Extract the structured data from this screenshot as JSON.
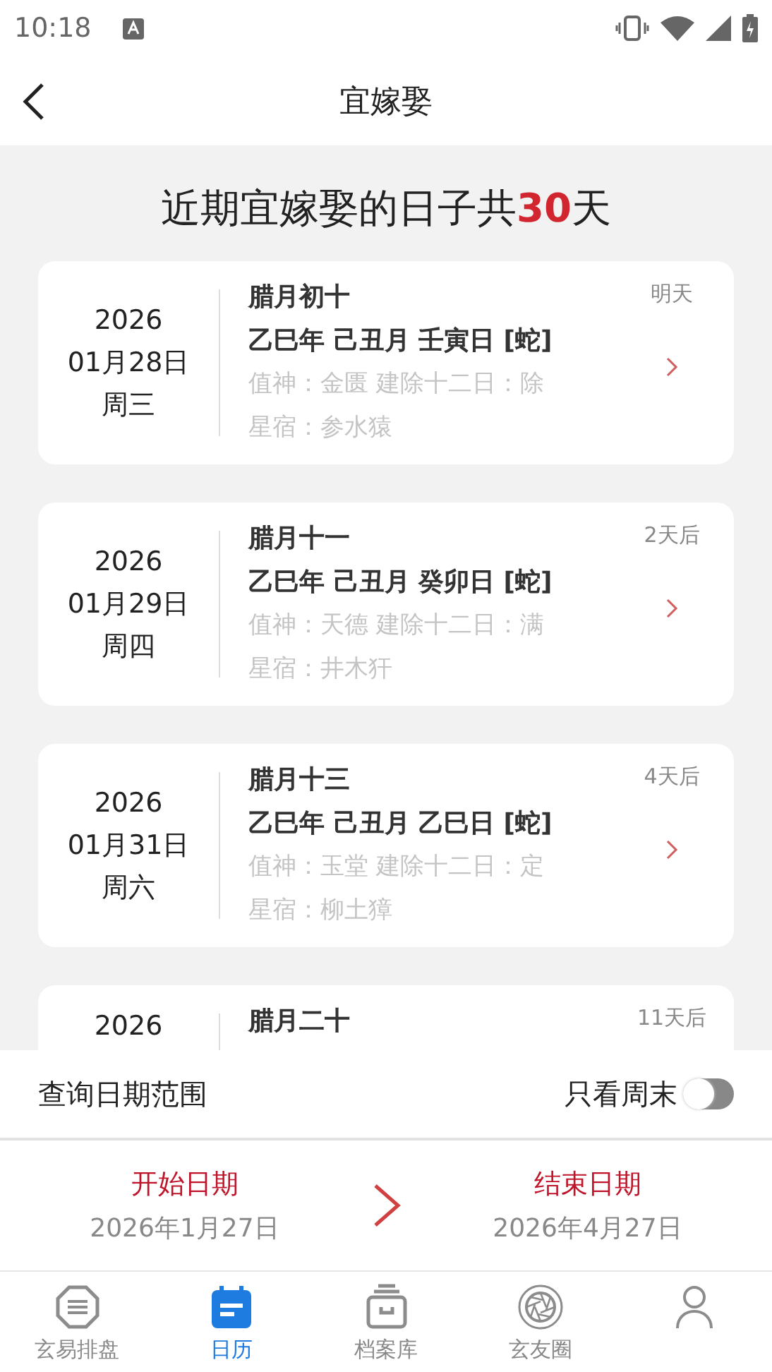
{
  "status_bar": {
    "time": "10:18"
  },
  "header": {
    "title": "宜嫁娶"
  },
  "summary": {
    "prefix": "近期宜嫁娶的日子共",
    "count": "30",
    "suffix": "天"
  },
  "days": [
    {
      "year": "2026",
      "date": "01月28日",
      "weekday": "周三",
      "lunar": "腊月初十",
      "ganzhi": "乙巳年 己丑月 壬寅日 [蛇]",
      "duty": "值神：金匮 建除十二日：除",
      "mansion": "星宿：参水猿",
      "relative": "明天"
    },
    {
      "year": "2026",
      "date": "01月29日",
      "weekday": "周四",
      "lunar": "腊月十一",
      "ganzhi": "乙巳年 己丑月 癸卯日 [蛇]",
      "duty": "值神：天德 建除十二日：满",
      "mansion": "星宿：井木犴",
      "relative": "2天后"
    },
    {
      "year": "2026",
      "date": "01月31日",
      "weekday": "周六",
      "lunar": "腊月十三",
      "ganzhi": "乙巳年 己丑月 乙巳日 [蛇]",
      "duty": "值神：玉堂 建除十二日：定",
      "mansion": "星宿：柳土獐",
      "relative": "4天后"
    },
    {
      "year": "2026",
      "lunar": "腊月二十",
      "relative": "11天后"
    }
  ],
  "filter": {
    "label": "查询日期范围",
    "weekend_label": "只看周末",
    "weekend_only": false
  },
  "range": {
    "start_label": "开始日期",
    "start_value": "2026年1月27日",
    "end_label": "结束日期",
    "end_value": "2026年4月27日"
  },
  "tabs": [
    {
      "kind": "octagon",
      "label": "玄易排盘",
      "selected": false
    },
    {
      "kind": "calendar",
      "label": "日历",
      "selected": true
    },
    {
      "kind": "box",
      "label": "档案库",
      "selected": false
    },
    {
      "kind": "aperture",
      "label": "玄友圈",
      "selected": false
    },
    {
      "kind": "person",
      "selected": false
    }
  ]
}
